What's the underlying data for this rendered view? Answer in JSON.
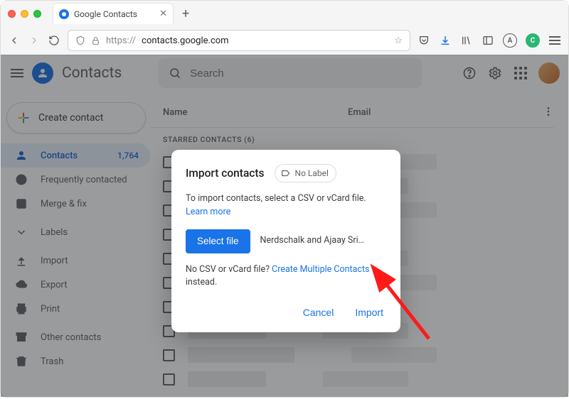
{
  "browser": {
    "tab_title": "Google Contacts",
    "url_scheme": "https://",
    "url_host": "contacts.google.com"
  },
  "app": {
    "title": "Contacts",
    "search_placeholder": "Search",
    "create_label": "Create contact"
  },
  "sidebar": {
    "items": [
      {
        "label": "Contacts",
        "count": "1,764"
      },
      {
        "label": "Frequently contacted"
      },
      {
        "label": "Merge & fix"
      }
    ],
    "labels_header": "Labels",
    "actions": [
      {
        "label": "Import"
      },
      {
        "label": "Export"
      },
      {
        "label": "Print"
      }
    ],
    "footer": [
      {
        "label": "Other contacts"
      },
      {
        "label": "Trash"
      }
    ]
  },
  "table": {
    "col_name": "Name",
    "col_email": "Email",
    "section_label": "STARRED CONTACTS (6)"
  },
  "modal": {
    "title": "Import contacts",
    "label_chip": "No Label",
    "help_text": "To import contacts, select a CSV or vCard file. ",
    "learn_more": "Learn more",
    "select_file": "Select file",
    "filename": "Nerdschalk and Ajaay Srini…",
    "nocsv_text": "No CSV or vCard file? ",
    "create_multiple": "Create Multiple Contacts",
    "instead_text": " instead.",
    "cancel": "Cancel",
    "import": "Import"
  }
}
